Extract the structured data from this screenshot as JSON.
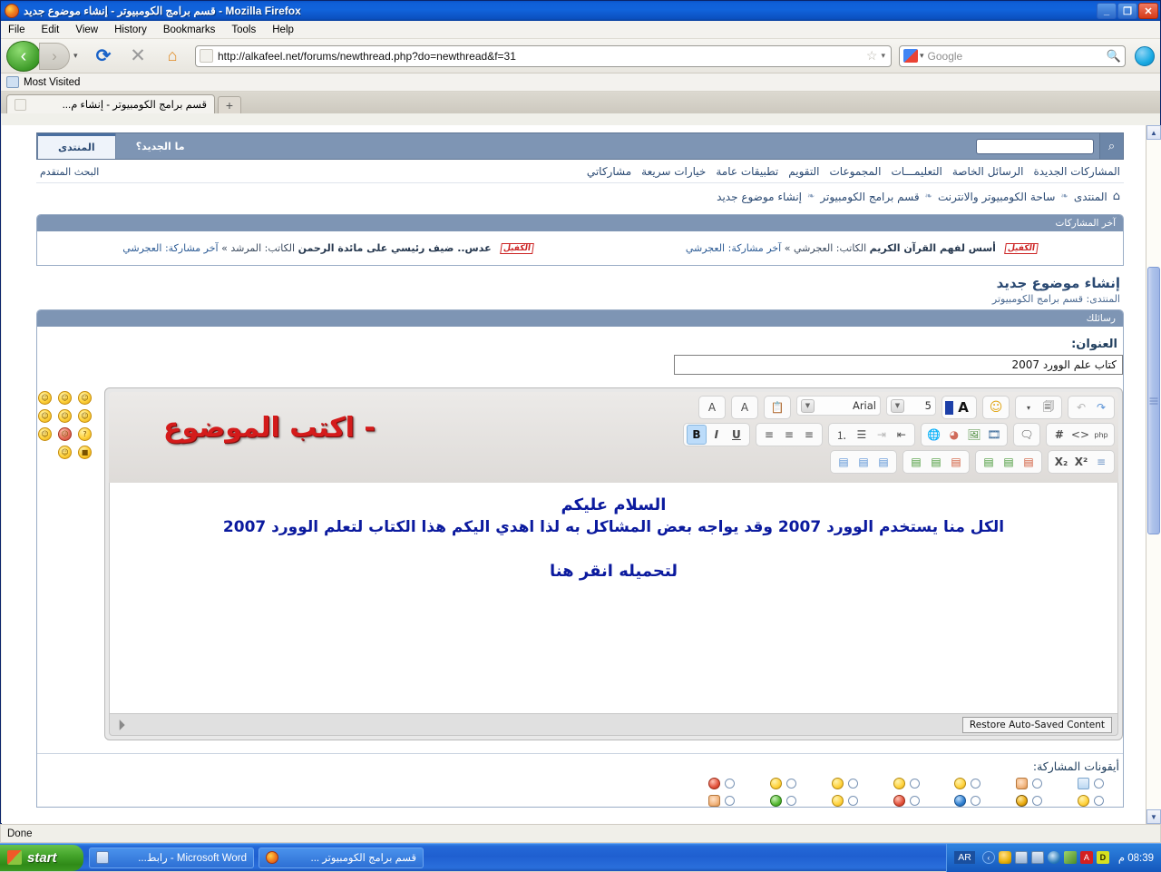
{
  "window": {
    "title": "قسم برامج الكومبيوتر - إنشاء موضوع جديد - Mozilla Firefox",
    "minimize_label": "_",
    "maximize_label": "❐",
    "close_label": "✕"
  },
  "menubar": [
    {
      "label": "File"
    },
    {
      "label": "Edit"
    },
    {
      "label": "View"
    },
    {
      "label": "History"
    },
    {
      "label": "Bookmarks"
    },
    {
      "label": "Tools"
    },
    {
      "label": "Help"
    }
  ],
  "toolbar": {
    "back_icon": "‹",
    "forward_icon": "›",
    "history_caret": "▾",
    "reload_icon": "⟳",
    "stop_icon": "✕",
    "home_icon": "⌂",
    "url": "http://alkafeel.net/forums/newthread.php?do=newthread&f=31",
    "star_icon": "☆",
    "url_caret": "▾",
    "search_placeholder": "Google",
    "search_caret": "▾",
    "search_icon": "🔍"
  },
  "bookmarks_bar": {
    "items": [
      {
        "label": "Most Visited"
      }
    ]
  },
  "tabs": {
    "items": [
      {
        "label": "قسم برامج الكومبيوتر - إنشاء م..."
      }
    ],
    "newtab_label": "+"
  },
  "forum": {
    "search": {
      "icon": "⌕",
      "value": ""
    },
    "tabs": [
      {
        "label": "المنتدى",
        "active": true
      },
      {
        "label": "ما الجديد؟",
        "active": false
      }
    ],
    "nav_links": [
      "المشاركات الجديدة",
      "الرسائل الخاصة",
      "التعليمـــات",
      "المجموعات",
      "التقويم",
      "تطبيقات عامة",
      "خيارات سريعة",
      "مشاركاتي"
    ],
    "advanced_search": "البحث المتقدم",
    "breadcrumb": {
      "home_icon": "⌂",
      "separator": "❧",
      "items": [
        "المنتدى",
        "ساحة الكومبيوتر والانترنت",
        "قسم برامج الكومبيوتر",
        "إنشاء موضوع جديد"
      ]
    },
    "last_posts": {
      "header": "آخر المشاركات",
      "items": [
        {
          "title": "عدس.. ضيف رئيسي على مائدة الرحمن",
          "author_label": "الكاتب: المرشد",
          "separator": "»",
          "lastpost_label": "آخر مشاركة: العجرشي",
          "badge": "الكفيل"
        },
        {
          "title": "أسس لفهم القرآن الكريم",
          "author_label": "الكاتب: العجرشي",
          "separator": "»",
          "lastpost_label": "آخر مشاركة: العجرشي",
          "badge": "الكفيل"
        }
      ]
    },
    "page_title": "إنشاء موضوع جديد",
    "page_subtitle": "المنتدى: قسم برامج الكومبيوتر",
    "message_panel_header": "رسائلك",
    "title_field": {
      "label": "العنوان:",
      "value": "كتاب علم الوورد 2007"
    },
    "editor": {
      "watermark": "- اكتب الموضوع",
      "font_family": "Arial",
      "font_size": "5",
      "toolbar_row1": [
        {
          "name": "undo-button",
          "glyph": "↶",
          "dim": true
        },
        {
          "name": "redo-button",
          "glyph": "↷",
          "dim": false
        },
        {
          "name": "attachment-caret",
          "glyph": "▾",
          "dim": false
        },
        {
          "name": "attachment-button",
          "glyph": "🗐",
          "dim": false
        },
        {
          "name": "smilies-button",
          "glyph": "☺",
          "dim": false
        },
        {
          "name": "font-color-button",
          "glyph": "A",
          "dim": false
        },
        {
          "name": "paste-from-word-button",
          "glyph": "📋",
          "dim": false
        },
        {
          "name": "remove-formatting-button",
          "glyph": "A",
          "dim": false
        },
        {
          "name": "switch-mode-button",
          "glyph": "A",
          "dim": false
        }
      ],
      "toolbar_row2": [
        {
          "name": "php-code-button",
          "glyph": "php"
        },
        {
          "name": "html-code-button",
          "glyph": "<>"
        },
        {
          "name": "code-button",
          "glyph": "#"
        },
        {
          "name": "quote-button",
          "glyph": "🗨"
        },
        {
          "name": "video-button",
          "glyph": "🎞"
        },
        {
          "name": "image-button",
          "glyph": "🖼"
        },
        {
          "name": "flash-button",
          "glyph": "◕"
        },
        {
          "name": "link-button",
          "glyph": "🌐"
        },
        {
          "name": "indent-button",
          "glyph": "⇤"
        },
        {
          "name": "outdent-button",
          "glyph": "⇥"
        },
        {
          "name": "bullet-list-button",
          "glyph": "☰"
        },
        {
          "name": "numbered-list-button",
          "glyph": "⒈"
        },
        {
          "name": "align-left-button",
          "glyph": "≡"
        },
        {
          "name": "align-center-button",
          "glyph": "≡"
        },
        {
          "name": "align-right-button",
          "glyph": "≡"
        },
        {
          "name": "underline-button",
          "glyph": "U"
        },
        {
          "name": "italic-button",
          "glyph": "I"
        },
        {
          "name": "bold-button",
          "glyph": "B"
        }
      ],
      "toolbar_row3": [
        {
          "name": "horizontal-rule-button",
          "glyph": "≡"
        },
        {
          "name": "superscript-button",
          "glyph": "X²"
        },
        {
          "name": "subscript-button",
          "glyph": "X₂"
        },
        {
          "name": "insert-table-button",
          "glyph": "▤"
        },
        {
          "name": "insert-row-below-button",
          "glyph": "▤"
        },
        {
          "name": "insert-row-button",
          "glyph": "▤"
        },
        {
          "name": "delete-column-button",
          "glyph": "▤"
        },
        {
          "name": "insert-column-button",
          "glyph": "▤"
        },
        {
          "name": "merge-cells-button",
          "glyph": "▤"
        },
        {
          "name": "delete-table-button",
          "glyph": "▤"
        },
        {
          "name": "table-properties-button",
          "glyph": "▤"
        },
        {
          "name": "cell-properties-button",
          "glyph": "▤"
        }
      ],
      "body_lines": [
        "السلام عليكم",
        "الكل منا يستخدم الوورد 2007 وقد يواجه بعض المشاكل به لذا اهدي اليكم هذا الكتاب لتعلم الوورد 2007",
        "لتحميله انقر هنا"
      ],
      "restore_button": "Restore Auto-Saved Content",
      "resize_grip": "◢"
    },
    "post_icons": {
      "label": "أيقونات المشاركة:",
      "items": [
        {
          "name": "icon-document",
          "style": "doc"
        },
        {
          "name": "icon-thumbs-down",
          "style": "hand"
        },
        {
          "name": "icon-talking",
          "style": "plain"
        },
        {
          "name": "icon-smile",
          "style": "plain"
        },
        {
          "name": "icon-big-grin",
          "style": "plain"
        },
        {
          "name": "icon-frown",
          "style": "plain"
        },
        {
          "name": "icon-angry",
          "style": "red"
        },
        {
          "name": "icon-wink",
          "style": "plain"
        },
        {
          "name": "icon-cool",
          "style": "dark"
        },
        {
          "name": "icon-question",
          "style": "blue"
        },
        {
          "name": "icon-exclamation",
          "style": "red"
        },
        {
          "name": "icon-idea",
          "style": "plain"
        },
        {
          "name": "icon-arrow",
          "style": "green"
        },
        {
          "name": "icon-thumbs-up",
          "style": "hand"
        }
      ]
    }
  },
  "scrollbar": {
    "up_arrow": "▲",
    "down_arrow": "▼"
  },
  "statusbar": {
    "text": "Done"
  },
  "taskbar": {
    "start_label": "start",
    "items": [
      {
        "label": "Microsoft Word - رابط...",
        "icon": "word",
        "rtl": true
      },
      {
        "label": "قسم برامج الكومبيوتر ...",
        "icon": "ff",
        "rtl": true
      }
    ],
    "tray": {
      "language": "AR",
      "chevron": "‹",
      "clock": "08:39 م"
    }
  }
}
